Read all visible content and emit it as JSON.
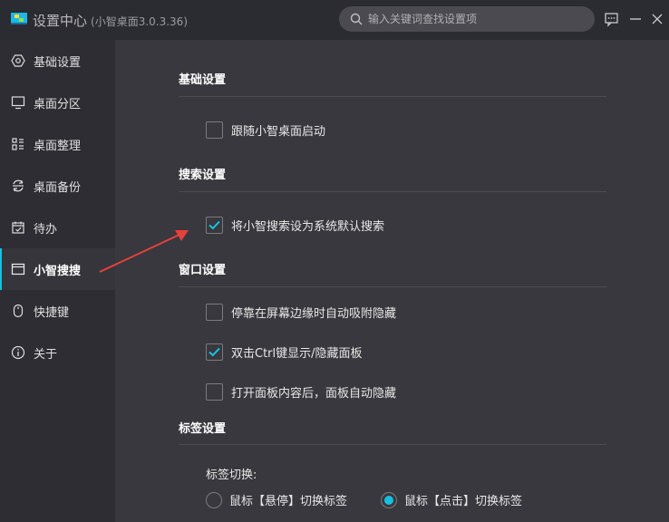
{
  "window": {
    "title": "设置中心",
    "version": "(小智桌面3.0.3.36)"
  },
  "search": {
    "placeholder": "输入关键词查找设置项",
    "value": ""
  },
  "sidebar": {
    "items": [
      {
        "label": "基础设置",
        "icon": "settings-hexagon-icon"
      },
      {
        "label": "桌面分区",
        "icon": "monitor-icon"
      },
      {
        "label": "桌面整理",
        "icon": "organize-icon"
      },
      {
        "label": "桌面备份",
        "icon": "backup-icon"
      },
      {
        "label": "待办",
        "icon": "calendar-check-icon"
      },
      {
        "label": "小智搜搜",
        "icon": "window-icon",
        "active": true
      },
      {
        "label": "快捷键",
        "icon": "mouse-icon"
      },
      {
        "label": "关于",
        "icon": "info-icon"
      }
    ]
  },
  "sections": {
    "basic": {
      "title": "基础设置",
      "follow_start": {
        "label": "跟随小智桌面启动",
        "checked": false
      }
    },
    "search": {
      "title": "搜索设置",
      "default_search": {
        "label": "将小智搜索设为系统默认搜索",
        "checked": true
      }
    },
    "window": {
      "title": "窗口设置",
      "dock_hide": {
        "label": "停靠在屏幕边缘时自动吸附隐藏",
        "checked": false
      },
      "ctrl_toggle": {
        "label": "双击Ctrl键显示/隐藏面板",
        "checked": true
      },
      "auto_hide": {
        "label": "打开面板内容后，面板自动隐藏",
        "checked": false
      }
    },
    "tabs": {
      "title": "标签设置",
      "switch_label": "标签切换:",
      "hover": {
        "label": "鼠标【悬停】切换标签",
        "selected": false
      },
      "click": {
        "label": "鼠标【点击】切换标签",
        "selected": true
      }
    }
  },
  "colors": {
    "accent": "#17c0e0",
    "arrow": "#e8403a"
  }
}
